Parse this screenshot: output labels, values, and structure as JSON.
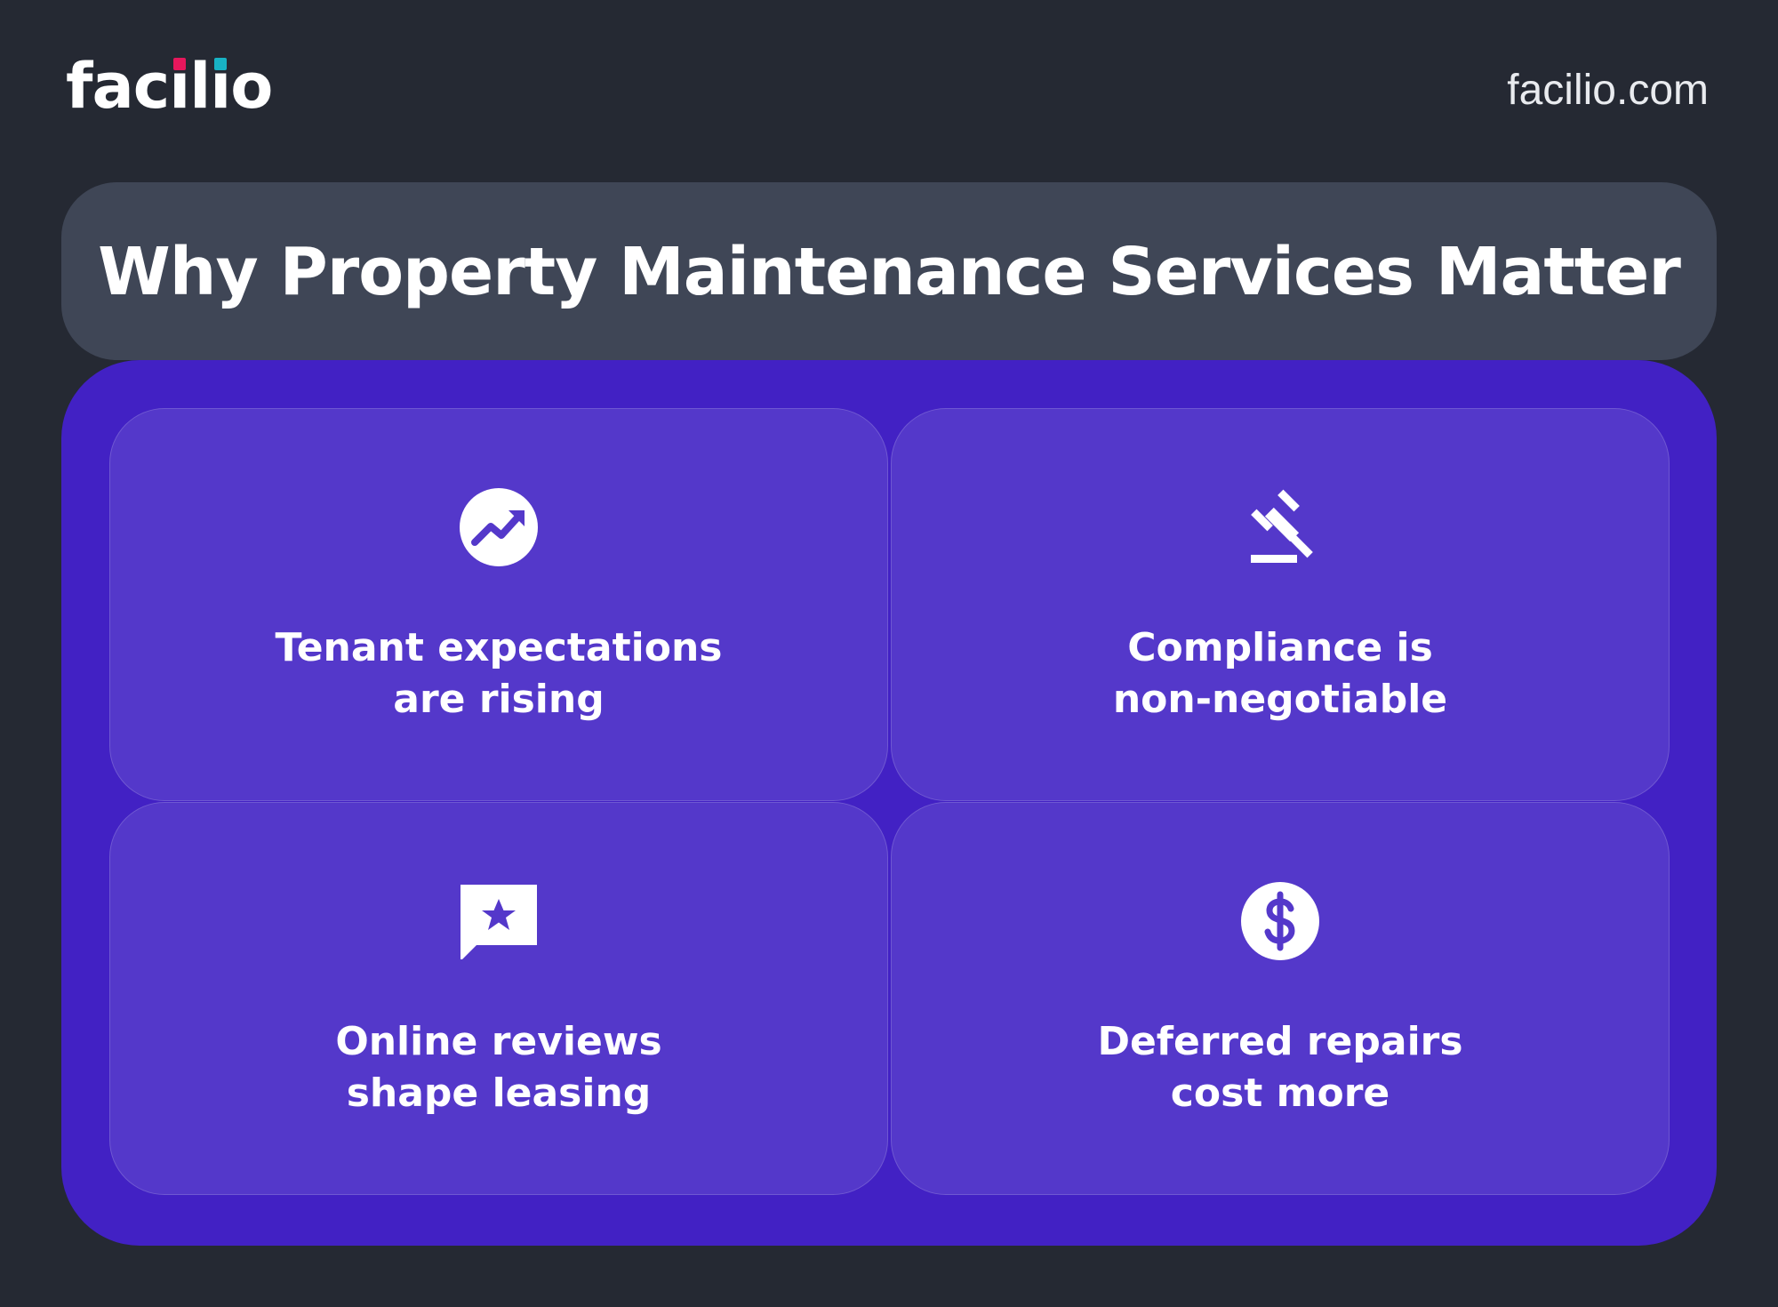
{
  "header": {
    "logo": {
      "prefix": "fac",
      "dotted_i_1": "i",
      "middle": "l",
      "dotted_i_2": "i",
      "suffix": "o",
      "dot_colors": [
        "#e6175c",
        "#18b2c4"
      ]
    },
    "site_url": "facilio.com"
  },
  "title": "Why Property Maintenance Services Matter",
  "colors": {
    "background": "#252933",
    "title_bar": "#3f4656",
    "panel": "#4221c4",
    "card": "#5438ca",
    "text": "#ffffff"
  },
  "cards": [
    {
      "icon": "trending-up-icon",
      "line1": "Tenant expectations",
      "line2": "are rising"
    },
    {
      "icon": "gavel-icon",
      "line1": "Compliance is",
      "line2": "non-negotiable"
    },
    {
      "icon": "review-star-icon",
      "line1": "Online reviews",
      "line2": "shape leasing"
    },
    {
      "icon": "dollar-icon",
      "line1": "Deferred repairs",
      "line2": "cost more"
    }
  ]
}
